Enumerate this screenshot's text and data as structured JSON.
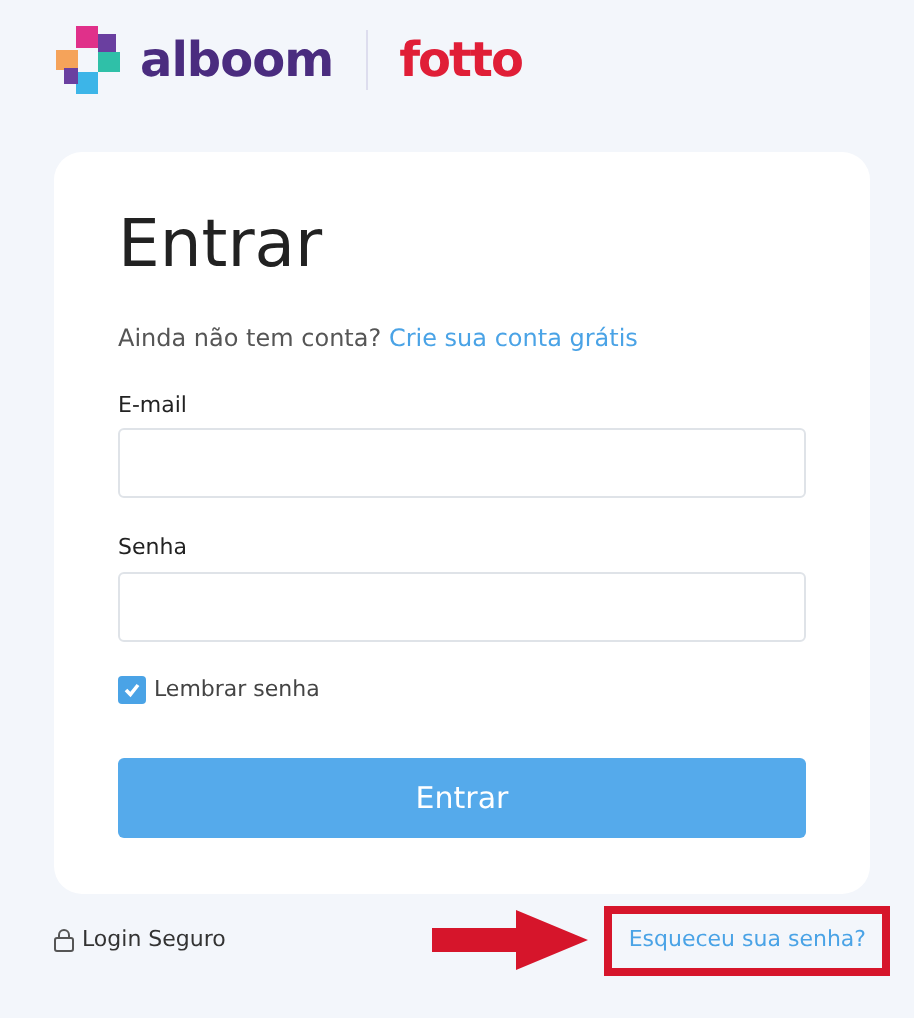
{
  "brand": {
    "primary": "alboom",
    "secondary": "fotto"
  },
  "form": {
    "title": "Entrar",
    "signup_prompt": "Ainda não tem conta?",
    "signup_link": "Crie sua conta grátis",
    "fields": [
      {
        "label": "E-mail"
      },
      {
        "label": "Senha"
      }
    ],
    "remember": {
      "label": "Lembrar senha",
      "checked": true
    },
    "submit": "Entrar"
  },
  "footer": {
    "secure": "Login Seguro",
    "forgot": {
      "label": "Esqueceu sua senha?",
      "highlighted": true
    }
  }
}
